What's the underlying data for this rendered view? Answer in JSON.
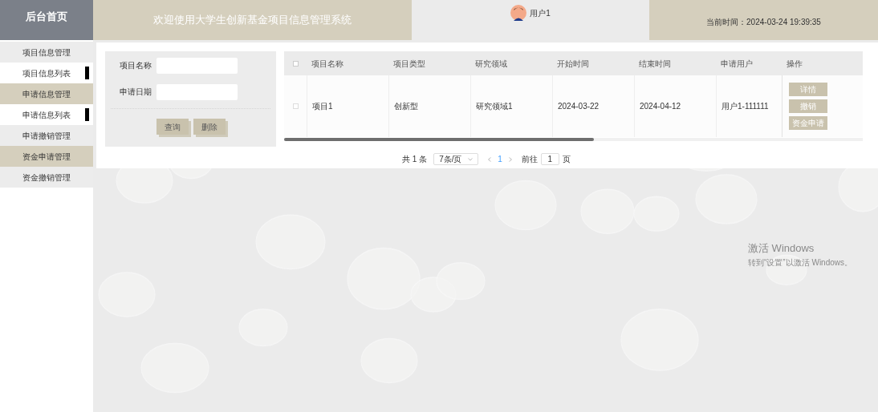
{
  "header": {
    "home": "后台首页",
    "title": "欢迎使用大学生创新基金项目信息管理系统",
    "user": "用户1",
    "time_label": "当前时间：",
    "time": "2024-03-24 19:39:35"
  },
  "sidebar": {
    "items": [
      {
        "kind": "group",
        "label": "项目信息管理"
      },
      {
        "kind": "sub",
        "label": "项目信息列表"
      },
      {
        "kind": "group",
        "label": "申请信息管理"
      },
      {
        "kind": "sub",
        "label": "申请信息列表"
      },
      {
        "kind": "group",
        "label": "申请撤销管理"
      },
      {
        "kind": "group",
        "label": "资金申请管理"
      },
      {
        "kind": "group",
        "label": "资金撤销管理"
      }
    ]
  },
  "search": {
    "fields": [
      {
        "label": "项目名称"
      },
      {
        "label": "申请日期"
      }
    ],
    "buttons": [
      "查询",
      "删除"
    ]
  },
  "table": {
    "select_all": {
      "checked": false
    },
    "columns": [
      "项目名称",
      "项目类型",
      "研究领域",
      "开始时间",
      "结束时间",
      "申请用户",
      "操作"
    ],
    "rows": [
      {
        "checked": false,
        "cells": [
          "项目1",
          "创新型",
          "研究领域1",
          "2024-03-22",
          "2024-04-12",
          "用户1-111111"
        ],
        "actions": [
          "详情",
          "撤销",
          "资金申请"
        ]
      }
    ]
  },
  "pagination": {
    "total": "共 1 条",
    "page_size": "7条/页",
    "pages": [
      {
        "label": "1",
        "selected": true
      }
    ],
    "goto_label": "前往",
    "goto_value": "1",
    "goto_suffix": "页"
  },
  "os_notice": {
    "title": "激活 Windows",
    "subtitle": "转到“设置”以激活 Windows。"
  }
}
